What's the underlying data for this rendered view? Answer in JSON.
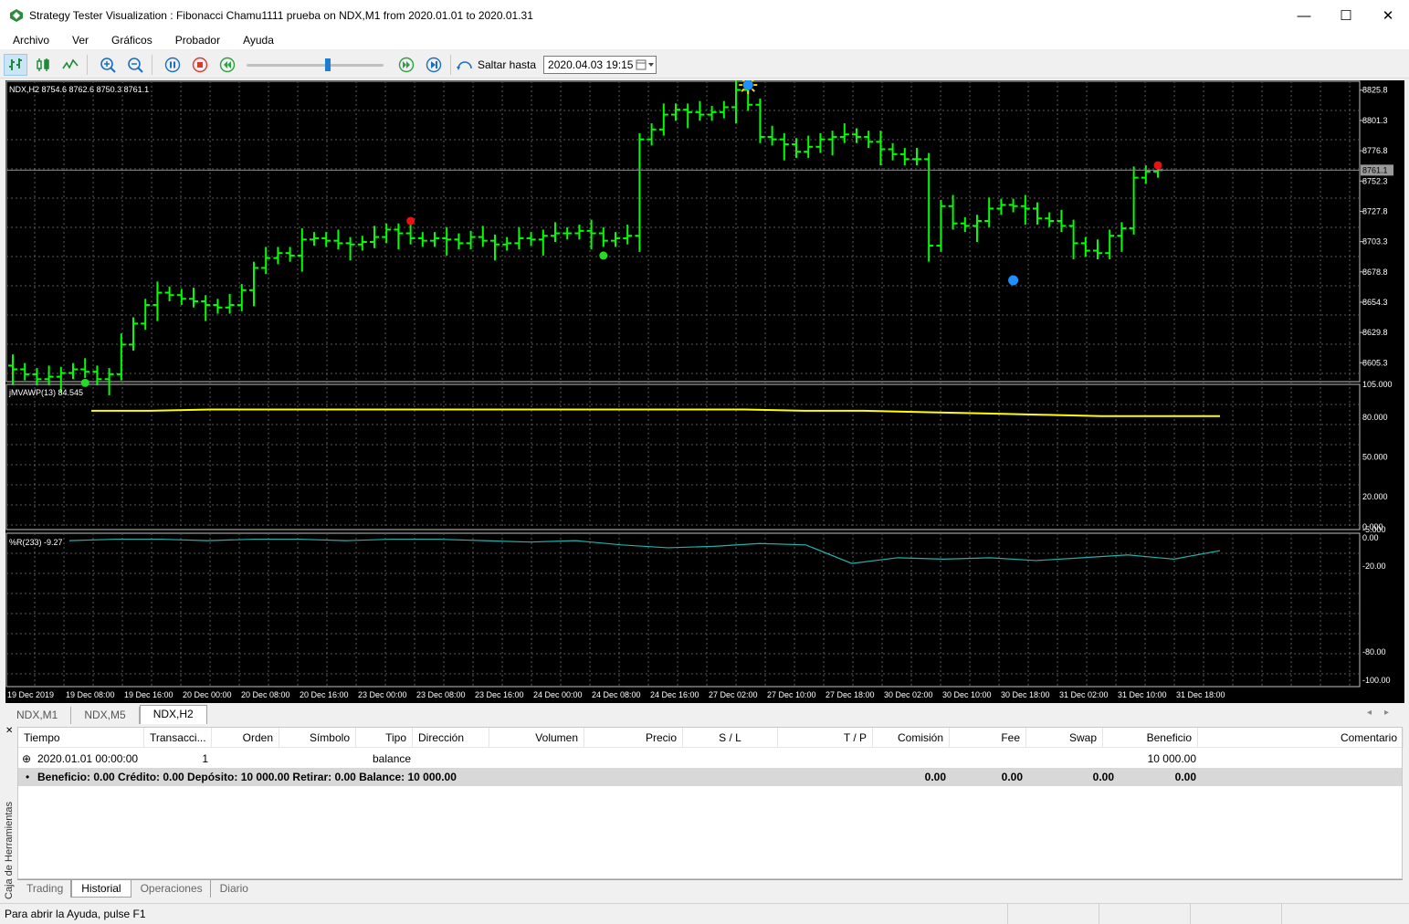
{
  "window": {
    "title": "Strategy Tester Visualization : Fibonacci Chamu1111 prueba on NDX,M1 from 2020.01.01 to 2020.01.31",
    "minimize": "—",
    "maximize": "☐",
    "close": "✕"
  },
  "menu": [
    "Archivo",
    "Ver",
    "Gráficos",
    "Probador",
    "Ayuda"
  ],
  "toolbar": {
    "goto_label": "Saltar hasta",
    "goto_value": "2020.04.03 19:15"
  },
  "chart": {
    "main_info": "NDX,H2  8754.6 8762.6 8750.3 8761.1",
    "price_ticks": [
      "8825.8",
      "8801.3",
      "8776.8",
      "8752.3",
      "8727.8",
      "8703.3",
      "8678.8",
      "8654.3",
      "8629.8",
      "8605.3"
    ],
    "current_price": "8761.1",
    "ind1_info": "jMVAWP(13) 84.545",
    "ind1_ticks": [
      "105.000",
      "80.000",
      "50.000",
      "20.000",
      "-5.000"
    ],
    "ind2_info": "%R(233) -9.27",
    "ind2_ticks": [
      "0.000",
      "0.00",
      "-20.00",
      "-80.00",
      "-100.00"
    ],
    "x_labels": [
      "19 Dec 2019",
      "19 Dec 08:00",
      "19 Dec 16:00",
      "20 Dec 00:00",
      "20 Dec 08:00",
      "20 Dec 16:00",
      "23 Dec 00:00",
      "23 Dec 08:00",
      "23 Dec 16:00",
      "24 Dec 00:00",
      "24 Dec 08:00",
      "24 Dec 16:00",
      "27 Dec 02:00",
      "27 Dec 10:00",
      "27 Dec 18:00",
      "30 Dec 02:00",
      "30 Dec 10:00",
      "30 Dec 18:00",
      "31 Dec 02:00",
      "31 Dec 10:00",
      "31 Dec 18:00"
    ],
    "colors": {
      "bars": "#00ff00",
      "ind1": "#ffff00",
      "ind2": "#20b2aa",
      "grid": "#5a5a5a"
    }
  },
  "chart_data": {
    "type": "ohlc",
    "close": [
      8600,
      8596,
      8592,
      8594,
      8597,
      8600,
      8598,
      8592,
      8596,
      8620,
      8637,
      8652,
      8662,
      8660,
      8657,
      8655,
      8652,
      8650,
      8652,
      8664,
      8682,
      8690,
      8694,
      8692,
      8705,
      8706,
      8704,
      8702,
      8701,
      8703,
      8707,
      8713,
      8710,
      8706,
      8704,
      8706,
      8705,
      8702,
      8707,
      8704,
      8701,
      8702,
      8706,
      8705,
      8708,
      8710,
      8710,
      8712,
      8710,
      8704,
      8706,
      8708,
      8786,
      8794,
      8806,
      8810,
      8808,
      8806,
      8808,
      8812,
      8826,
      8814,
      8788,
      8786,
      8782,
      8776,
      8780,
      8786,
      8788,
      8790,
      8788,
      8784,
      8778,
      8774,
      8770,
      8770,
      8700,
      8732,
      8718,
      8716,
      8720,
      8730,
      8733,
      8732,
      8730,
      8722,
      8720,
      8716,
      8702,
      8696,
      8694,
      8708,
      8714,
      8755,
      8760,
      8761.1
    ],
    "signals": [
      {
        "bar": 6,
        "kind": "buy",
        "price": 8589
      },
      {
        "bar": 33,
        "kind": "sell",
        "price": 8720
      },
      {
        "bar": 49,
        "kind": "buy",
        "price": 8692
      },
      {
        "bar": 61,
        "kind": "entry",
        "price": 8830
      },
      {
        "bar": 83,
        "kind": "entry",
        "price": 8672
      },
      {
        "bar": 95,
        "kind": "sell",
        "price": 8765
      }
    ],
    "ylim": [
      8590,
      8833
    ],
    "ind1_series": [
      85,
      85,
      86,
      86,
      86,
      86,
      86,
      86,
      86,
      86,
      86,
      86,
      85,
      85,
      84,
      83,
      82,
      81,
      81,
      81
    ],
    "ind1_ylim": [
      -5,
      105
    ],
    "ind2_series": [
      -2,
      -1,
      -1,
      -2,
      -1,
      -1,
      -2,
      -1,
      -1,
      -2,
      -3,
      -2,
      -5,
      -7,
      -6,
      -4,
      -5,
      -18,
      -14,
      -15,
      -14,
      -16,
      -14,
      -12,
      -15,
      -9
    ],
    "ind2_ylim": [
      -105,
      5
    ]
  },
  "chart_tabs": [
    "NDX,M1",
    "NDX,M5",
    "NDX,H2"
  ],
  "table": {
    "columns": [
      "Tiempo",
      "Transacci...",
      "Orden",
      "Símbolo",
      "Tipo",
      "Dirección",
      "Volumen",
      "Precio",
      "S / L",
      "T / P",
      "Comisión",
      "Fee",
      "Swap",
      "Beneficio",
      "Comentario"
    ],
    "row": {
      "time": "2020.01.01 00:00:00",
      "deal": "1",
      "type": "balance",
      "profit": "10 000.00"
    },
    "summary": {
      "text": "Beneficio: 0.00  Crédito: 0.00  Depósito: 10 000.00  Retirar: 0.00  Balance: 10 000.00",
      "commission": "0.00",
      "fee": "0.00",
      "swap": "0.00",
      "profit": "0.00"
    }
  },
  "side_tab": "Caja de Herramientas",
  "bottom_tabs": [
    "Trading",
    "Historial",
    "Operaciones",
    "Diario"
  ],
  "status": "Para abrir la Ayuda, pulse F1"
}
